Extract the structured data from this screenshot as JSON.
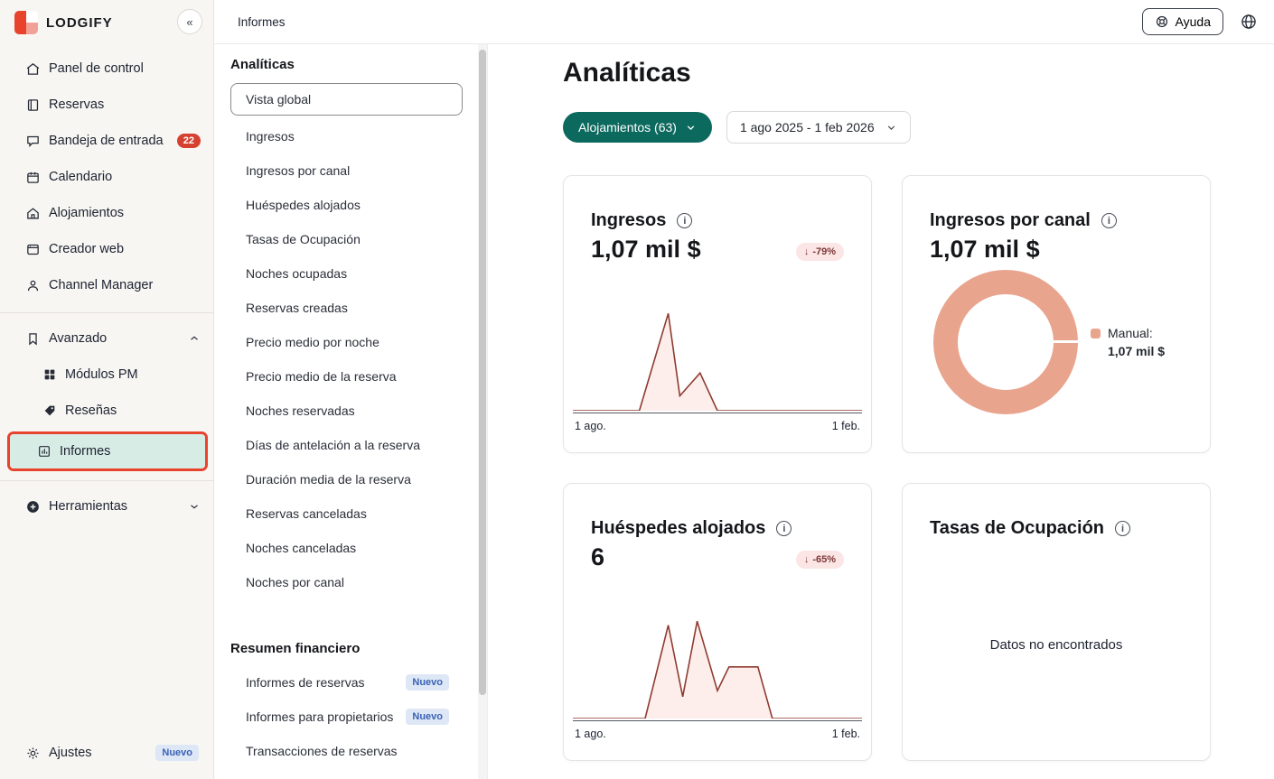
{
  "brand": {
    "name": "LODGIFY",
    "collapse": "«"
  },
  "nav": {
    "items": [
      {
        "label": "Panel de control"
      },
      {
        "label": "Reservas"
      },
      {
        "label": "Bandeja de entrada",
        "badge": "22"
      },
      {
        "label": "Calendario"
      },
      {
        "label": "Alojamientos"
      },
      {
        "label": "Creador web"
      },
      {
        "label": "Channel Manager"
      }
    ],
    "advanced": {
      "label": "Avanzado"
    },
    "advanced_children": [
      {
        "label": "Módulos PM"
      },
      {
        "label": "Reseñas"
      },
      {
        "label": "Informes",
        "selected": true
      }
    ],
    "tools": {
      "label": "Herramientas"
    },
    "settings": {
      "label": "Ajustes",
      "badge": "Nuevo"
    }
  },
  "topbar": {
    "breadcrumb": "Informes",
    "help": "Ayuda"
  },
  "subnav": {
    "analytics_title": "Analíticas",
    "items": [
      {
        "label": "Vista global",
        "selected": true
      },
      {
        "label": "Ingresos"
      },
      {
        "label": "Ingresos por canal"
      },
      {
        "label": "Huéspedes alojados"
      },
      {
        "label": "Tasas de Ocupación"
      },
      {
        "label": "Noches ocupadas"
      },
      {
        "label": "Reservas creadas"
      },
      {
        "label": "Precio medio por noche"
      },
      {
        "label": "Precio medio de la reserva"
      },
      {
        "label": "Noches reservadas"
      },
      {
        "label": "Días de antelación a la reserva"
      },
      {
        "label": "Duración media de la reserva"
      },
      {
        "label": "Reservas canceladas"
      },
      {
        "label": "Noches canceladas"
      },
      {
        "label": "Noches por canal"
      }
    ],
    "financial_title": "Resumen financiero",
    "financial_items": [
      {
        "label": "Informes de reservas",
        "badge": "Nuevo"
      },
      {
        "label": "Informes para propietarios",
        "badge": "Nuevo"
      },
      {
        "label": "Transacciones de reservas"
      }
    ]
  },
  "main": {
    "title": "Analíticas",
    "filters": {
      "accommodations": "Alojamientos (63)",
      "date_range": "1 ago 2025 - 1 feb 2026"
    },
    "cards": {
      "ingresos": {
        "title": "Ingresos",
        "value": "1,07 mil $",
        "delta": "-79%",
        "delta_arrow": "↓",
        "x_start": "1 ago.",
        "x_end": "1 feb."
      },
      "canal": {
        "title": "Ingresos por canal",
        "value": "1,07 mil $",
        "legend_label": "Manual:",
        "legend_value": "1,07 mil $"
      },
      "huespedes": {
        "title": "Huéspedes alojados",
        "value": "6",
        "delta": "-65%",
        "delta_arrow": "↓",
        "x_start": "1 ago.",
        "x_end": "1 feb."
      },
      "ocupacion": {
        "title": "Tasas de Ocupación",
        "empty": "Datos no encontrados"
      }
    }
  },
  "colors": {
    "accent_teal": "#0c695e",
    "selected_teal_bg": "#d8ece6",
    "highlight_red": "#e8432d",
    "badge_red": "#d5402f",
    "chart_line": "#8e3b31",
    "chart_fill": "#fdeeec",
    "donut": "#e9a48e",
    "delta_bg": "#fbe5e5",
    "nuevo_bg": "#dde7f6"
  },
  "chart_data": [
    {
      "type": "area",
      "metric": "Ingresos",
      "x_axis": [
        "1 ago.",
        "1 feb."
      ],
      "points": [
        [
          0,
          100
        ],
        [
          23,
          100
        ],
        [
          33,
          2
        ],
        [
          37,
          85
        ],
        [
          44,
          62
        ],
        [
          50,
          100
        ],
        [
          100,
          100
        ]
      ]
    },
    {
      "type": "donut",
      "metric": "Ingresos por canal",
      "segments": [
        {
          "label": "Manual",
          "value": "1,07 mil $",
          "percent": 100,
          "color": "#e9a48e"
        }
      ]
    },
    {
      "type": "area",
      "metric": "Huéspedes alojados",
      "x_axis": [
        "1 ago.",
        "1 feb."
      ],
      "points": [
        [
          0,
          100
        ],
        [
          25,
          100
        ],
        [
          33,
          6
        ],
        [
          38,
          78
        ],
        [
          43,
          2
        ],
        [
          50,
          72
        ],
        [
          54,
          48
        ],
        [
          64,
          48
        ],
        [
          69,
          100
        ],
        [
          100,
          100
        ]
      ]
    },
    {
      "type": "empty",
      "metric": "Tasas de Ocupación",
      "message": "Datos no encontrados"
    }
  ]
}
